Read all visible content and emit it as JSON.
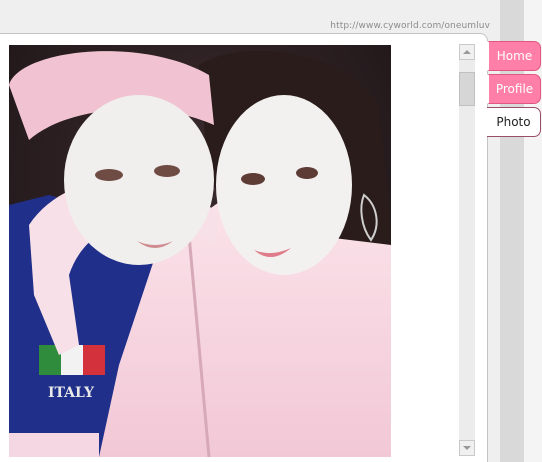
{
  "page": {
    "url_text": "http://www.cyworld.com/oneumluv"
  },
  "photo": {
    "alt": "",
    "shirt_text": "ITALY"
  },
  "tabs": [
    {
      "label": "Home",
      "active": false
    },
    {
      "label": "Profile",
      "active": false
    },
    {
      "label": "Photo",
      "active": true
    }
  ],
  "colors": {
    "tab_pink": "#ff7fa8",
    "tab_pink_border": "#e0577f",
    "active_tab_border": "#9b4d64",
    "url_text": "#8c8c8c"
  },
  "icons": {
    "scroll_up": "triangle-up",
    "scroll_down": "triangle-down"
  }
}
